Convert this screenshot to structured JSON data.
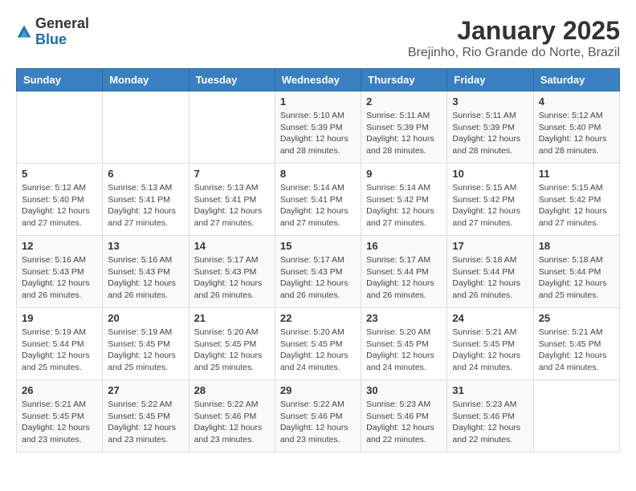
{
  "logo": {
    "general": "General",
    "blue": "Blue"
  },
  "header": {
    "title": "January 2025",
    "subtitle": "Brejinho, Rio Grande do Norte, Brazil"
  },
  "days_of_week": [
    "Sunday",
    "Monday",
    "Tuesday",
    "Wednesday",
    "Thursday",
    "Friday",
    "Saturday"
  ],
  "weeks": [
    [
      {
        "day": "",
        "info": ""
      },
      {
        "day": "",
        "info": ""
      },
      {
        "day": "",
        "info": ""
      },
      {
        "day": "1",
        "info": "Sunrise: 5:10 AM\nSunset: 5:39 PM\nDaylight: 12 hours\nand 28 minutes."
      },
      {
        "day": "2",
        "info": "Sunrise: 5:11 AM\nSunset: 5:39 PM\nDaylight: 12 hours\nand 28 minutes."
      },
      {
        "day": "3",
        "info": "Sunrise: 5:11 AM\nSunset: 5:39 PM\nDaylight: 12 hours\nand 28 minutes."
      },
      {
        "day": "4",
        "info": "Sunrise: 5:12 AM\nSunset: 5:40 PM\nDaylight: 12 hours\nand 28 minutes."
      }
    ],
    [
      {
        "day": "5",
        "info": "Sunrise: 5:12 AM\nSunset: 5:40 PM\nDaylight: 12 hours\nand 27 minutes."
      },
      {
        "day": "6",
        "info": "Sunrise: 5:13 AM\nSunset: 5:41 PM\nDaylight: 12 hours\nand 27 minutes."
      },
      {
        "day": "7",
        "info": "Sunrise: 5:13 AM\nSunset: 5:41 PM\nDaylight: 12 hours\nand 27 minutes."
      },
      {
        "day": "8",
        "info": "Sunrise: 5:14 AM\nSunset: 5:41 PM\nDaylight: 12 hours\nand 27 minutes."
      },
      {
        "day": "9",
        "info": "Sunrise: 5:14 AM\nSunset: 5:42 PM\nDaylight: 12 hours\nand 27 minutes."
      },
      {
        "day": "10",
        "info": "Sunrise: 5:15 AM\nSunset: 5:42 PM\nDaylight: 12 hours\nand 27 minutes."
      },
      {
        "day": "11",
        "info": "Sunrise: 5:15 AM\nSunset: 5:42 PM\nDaylight: 12 hours\nand 27 minutes."
      }
    ],
    [
      {
        "day": "12",
        "info": "Sunrise: 5:16 AM\nSunset: 5:43 PM\nDaylight: 12 hours\nand 26 minutes."
      },
      {
        "day": "13",
        "info": "Sunrise: 5:16 AM\nSunset: 5:43 PM\nDaylight: 12 hours\nand 26 minutes."
      },
      {
        "day": "14",
        "info": "Sunrise: 5:17 AM\nSunset: 5:43 PM\nDaylight: 12 hours\nand 26 minutes."
      },
      {
        "day": "15",
        "info": "Sunrise: 5:17 AM\nSunset: 5:43 PM\nDaylight: 12 hours\nand 26 minutes."
      },
      {
        "day": "16",
        "info": "Sunrise: 5:17 AM\nSunset: 5:44 PM\nDaylight: 12 hours\nand 26 minutes."
      },
      {
        "day": "17",
        "info": "Sunrise: 5:18 AM\nSunset: 5:44 PM\nDaylight: 12 hours\nand 26 minutes."
      },
      {
        "day": "18",
        "info": "Sunrise: 5:18 AM\nSunset: 5:44 PM\nDaylight: 12 hours\nand 25 minutes."
      }
    ],
    [
      {
        "day": "19",
        "info": "Sunrise: 5:19 AM\nSunset: 5:44 PM\nDaylight: 12 hours\nand 25 minutes."
      },
      {
        "day": "20",
        "info": "Sunrise: 5:19 AM\nSunset: 5:45 PM\nDaylight: 12 hours\nand 25 minutes."
      },
      {
        "day": "21",
        "info": "Sunrise: 5:20 AM\nSunset: 5:45 PM\nDaylight: 12 hours\nand 25 minutes."
      },
      {
        "day": "22",
        "info": "Sunrise: 5:20 AM\nSunset: 5:45 PM\nDaylight: 12 hours\nand 24 minutes."
      },
      {
        "day": "23",
        "info": "Sunrise: 5:20 AM\nSunset: 5:45 PM\nDaylight: 12 hours\nand 24 minutes."
      },
      {
        "day": "24",
        "info": "Sunrise: 5:21 AM\nSunset: 5:45 PM\nDaylight: 12 hours\nand 24 minutes."
      },
      {
        "day": "25",
        "info": "Sunrise: 5:21 AM\nSunset: 5:45 PM\nDaylight: 12 hours\nand 24 minutes."
      }
    ],
    [
      {
        "day": "26",
        "info": "Sunrise: 5:21 AM\nSunset: 5:45 PM\nDaylight: 12 hours\nand 23 minutes."
      },
      {
        "day": "27",
        "info": "Sunrise: 5:22 AM\nSunset: 5:45 PM\nDaylight: 12 hours\nand 23 minutes."
      },
      {
        "day": "28",
        "info": "Sunrise: 5:22 AM\nSunset: 5:46 PM\nDaylight: 12 hours\nand 23 minutes."
      },
      {
        "day": "29",
        "info": "Sunrise: 5:22 AM\nSunset: 5:46 PM\nDaylight: 12 hours\nand 23 minutes."
      },
      {
        "day": "30",
        "info": "Sunrise: 5:23 AM\nSunset: 5:46 PM\nDaylight: 12 hours\nand 22 minutes."
      },
      {
        "day": "31",
        "info": "Sunrise: 5:23 AM\nSunset: 5:46 PM\nDaylight: 12 hours\nand 22 minutes."
      },
      {
        "day": "",
        "info": ""
      }
    ]
  ]
}
